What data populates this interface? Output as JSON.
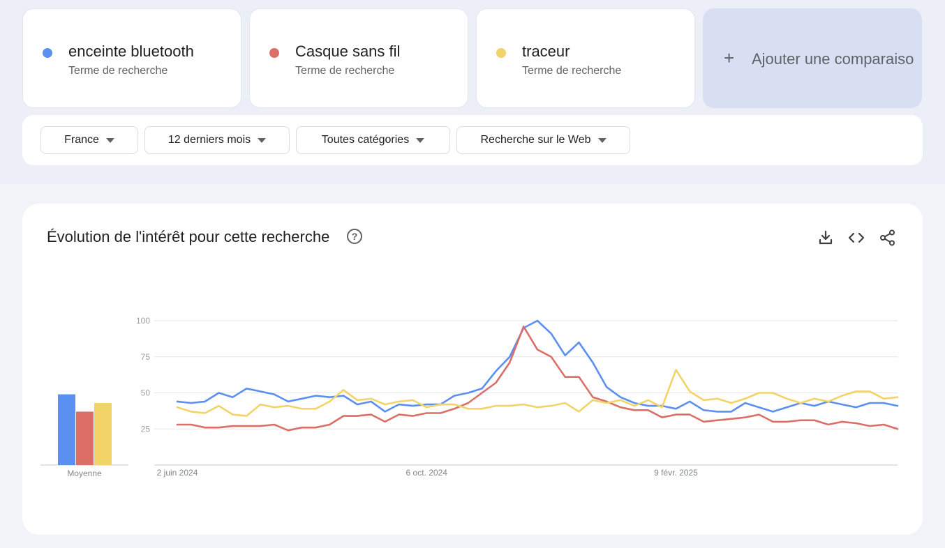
{
  "terms": [
    {
      "name": "enceinte bluetooth",
      "subtitle": "Terme de recherche",
      "color": "#5b8ff0"
    },
    {
      "name": "Casque sans fil",
      "subtitle": "Terme de recherche",
      "color": "#db6f67"
    },
    {
      "name": "traceur",
      "subtitle": "Terme de recherche",
      "color": "#f2d368"
    }
  ],
  "add_comparison": {
    "label": "Ajouter une comparaiso",
    "icon": "plus-icon"
  },
  "filters": {
    "region": "France",
    "period": "12 derniers mois",
    "category": "Toutes catégories",
    "search_type": "Recherche sur le Web"
  },
  "chart_card": {
    "title": "Évolution de l'intérêt pour cette recherche",
    "help_icon": "?",
    "tools": [
      "download-icon",
      "embed-code-icon",
      "share-icon"
    ]
  },
  "chart_data": {
    "type": "line",
    "y_ticks": [
      "25",
      "50",
      "75",
      "100"
    ],
    "ylim": [
      0,
      100
    ],
    "x_tick_labels": [
      "2 juin 2024",
      "6 oct. 2024",
      "9 févr. 2025"
    ],
    "x_tick_indices": [
      0,
      18,
      36
    ],
    "grid": true,
    "average_label": "Moyenne",
    "averages": [
      49,
      37,
      43
    ],
    "series": [
      {
        "name": "enceinte bluetooth",
        "color": "#5b8ff0",
        "values": [
          44,
          43,
          44,
          50,
          47,
          53,
          51,
          49,
          44,
          46,
          48,
          47,
          48,
          42,
          44,
          37,
          42,
          41,
          42,
          42,
          48,
          50,
          53,
          65,
          75,
          95,
          100,
          91,
          76,
          85,
          71,
          54,
          47,
          43,
          41,
          41,
          39,
          44,
          38,
          37,
          37,
          43,
          40,
          37,
          40,
          43,
          41,
          44,
          42,
          40,
          43,
          43,
          41
        ]
      },
      {
        "name": "Casque sans fil",
        "color": "#db6f67",
        "values": [
          28,
          28,
          26,
          26,
          27,
          27,
          27,
          28,
          24,
          26,
          26,
          28,
          34,
          34,
          35,
          30,
          35,
          34,
          36,
          36,
          39,
          43,
          50,
          57,
          71,
          96,
          80,
          75,
          61,
          61,
          47,
          44,
          40,
          38,
          38,
          33,
          35,
          35,
          30,
          31,
          32,
          33,
          35,
          30,
          30,
          31,
          31,
          28,
          30,
          29,
          27,
          28,
          25
        ]
      },
      {
        "name": "traceur",
        "color": "#f2d368",
        "values": [
          40,
          37,
          36,
          41,
          35,
          34,
          42,
          40,
          41,
          39,
          39,
          44,
          52,
          45,
          46,
          42,
          44,
          45,
          40,
          42,
          42,
          39,
          39,
          41,
          41,
          42,
          40,
          41,
          43,
          37,
          45,
          43,
          45,
          41,
          45,
          40,
          66,
          51,
          45,
          46,
          43,
          46,
          50,
          50,
          46,
          43,
          46,
          44,
          48,
          51,
          51,
          46,
          47
        ]
      }
    ]
  }
}
